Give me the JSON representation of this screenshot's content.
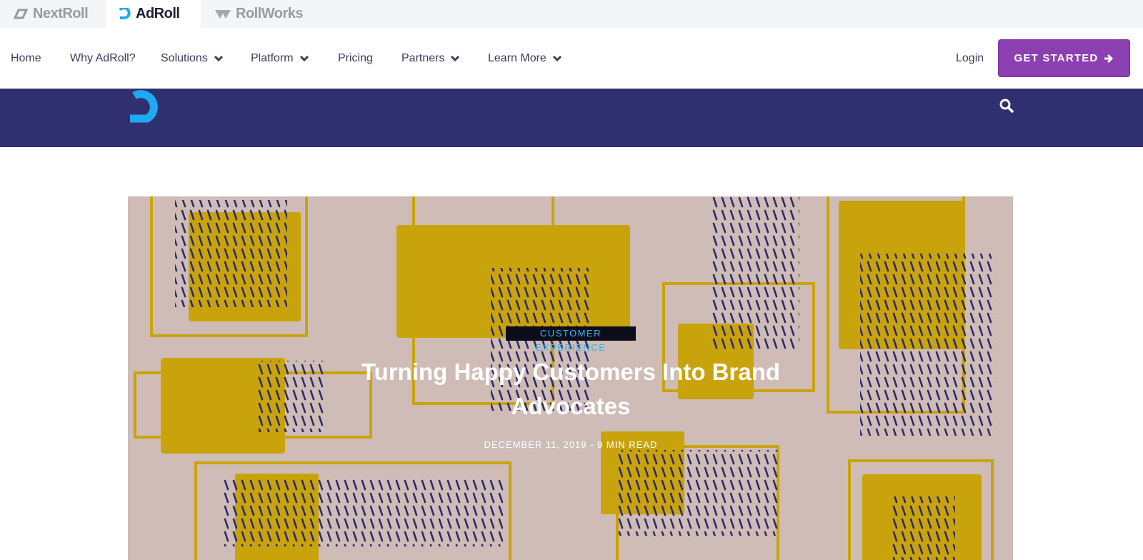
{
  "brand_bar": {
    "tabs": [
      {
        "label": "NextRoll",
        "icon": "nextroll-logo-icon"
      },
      {
        "label": "AdRoll",
        "icon": "adroll-logo-icon",
        "active": true
      },
      {
        "label": "RollWorks",
        "icon": "rollworks-logo-icon"
      }
    ]
  },
  "nav": {
    "items": [
      {
        "label": "Home",
        "dropdown": false
      },
      {
        "label": "Why AdRoll?",
        "dropdown": false
      },
      {
        "label": "Solutions",
        "dropdown": true
      },
      {
        "label": "Platform",
        "dropdown": true
      },
      {
        "label": "Pricing",
        "dropdown": false
      },
      {
        "label": "Partners",
        "dropdown": true
      },
      {
        "label": "Learn More",
        "dropdown": true
      }
    ],
    "login": "Login",
    "cta": "GET STARTED"
  },
  "blog_header": {
    "logo_icon": "adroll-blog-logo-icon",
    "search_icon": "search-icon"
  },
  "hero": {
    "category": "CUSTOMER EXPERIENCE",
    "title": "Turning Happy Customers Into Brand Advocates",
    "meta": "DECEMBER 11, 2019 - 9 MIN READ"
  },
  "colors": {
    "brand_bar_bg": "#f4f5f9",
    "nav_text": "#3a3d5c",
    "cta_bg": "#8b3fb0",
    "blog_band_bg": "#303070",
    "adroll_blue": "#1eaaf1",
    "hero_bg": "#cfbcb6",
    "pattern_gold": "#c9a30c",
    "pattern_navy": "#2c2a6a"
  }
}
